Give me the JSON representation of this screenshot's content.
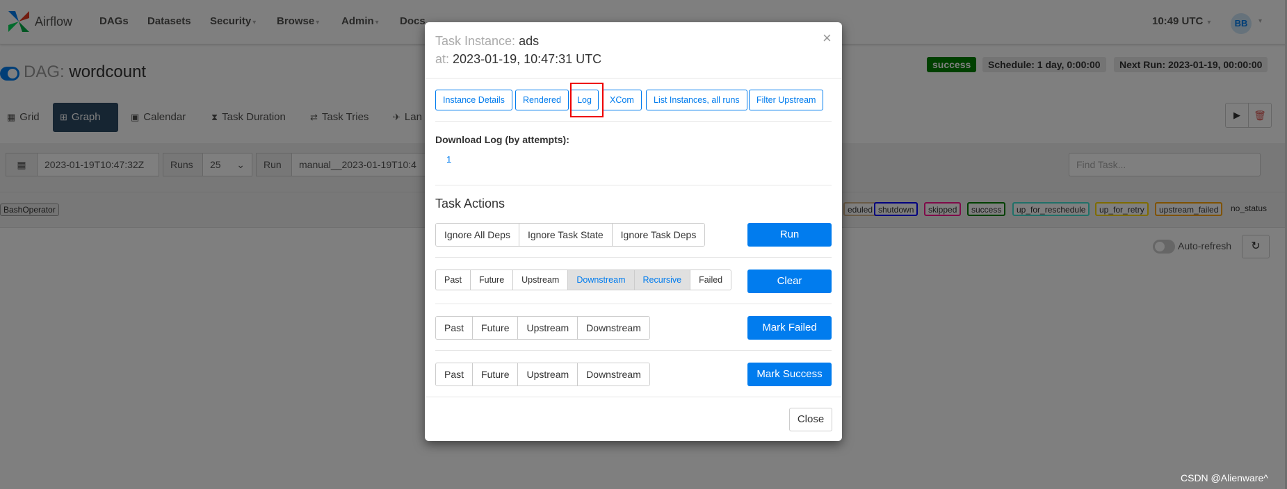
{
  "nav": {
    "brand": "Airflow",
    "items": [
      "DAGs",
      "Datasets",
      "Security",
      "Browse",
      "Admin",
      "Docs"
    ],
    "time": "10:49 UTC",
    "avatar": "BB"
  },
  "dag": {
    "prefix": "DAG:",
    "name": "wordcount",
    "status": "success",
    "schedule": "Schedule: 1 day, 0:00:00",
    "next_run": "Next Run: 2023-01-19, 00:00:00"
  },
  "tabs": [
    "Grid",
    "Graph",
    "Calendar",
    "Task Duration",
    "Task Tries",
    "Lan"
  ],
  "filters": {
    "date": "2023-01-19T10:47:32Z",
    "runs_label": "Runs",
    "runs_value": "25",
    "run_label": "Run",
    "run_value": "manual__2023-01-19T10:4",
    "find_placeholder": "Find Task..."
  },
  "legend": {
    "operator": "BashOperator",
    "states": [
      {
        "label": "eduled",
        "color": "#d2b48c"
      },
      {
        "label": "shutdown",
        "color": "#0000ff"
      },
      {
        "label": "skipped",
        "color": "#ff1493"
      },
      {
        "label": "success",
        "color": "#008000"
      },
      {
        "label": "up_for_reschedule",
        "color": "#40e0d0"
      },
      {
        "label": "up_for_retry",
        "color": "#ffd700"
      },
      {
        "label": "upstream_failed",
        "color": "#ffa500"
      }
    ],
    "no_status": "no_status"
  },
  "autorefresh": "Auto-refresh",
  "modal": {
    "title_label": "Task Instance:",
    "task": "ads",
    "at_label": "at:",
    "at_value": "2023-01-19, 10:47:31 UTC",
    "top_buttons": [
      "Instance Details",
      "Rendered",
      "Log",
      "XCom",
      "List Instances, all runs",
      "Filter Upstream"
    ],
    "download_label": "Download Log (by attempts):",
    "attempt": "1",
    "actions_title": "Task Actions",
    "run_options": [
      "Ignore All Deps",
      "Ignore Task State",
      "Ignore Task Deps"
    ],
    "run_label": "Run",
    "clear_options": [
      "Past",
      "Future",
      "Upstream",
      "Downstream",
      "Recursive",
      "Failed"
    ],
    "clear_label": "Clear",
    "failed_options": [
      "Past",
      "Future",
      "Upstream",
      "Downstream"
    ],
    "failed_label": "Mark Failed",
    "success_options": [
      "Past",
      "Future",
      "Upstream",
      "Downstream"
    ],
    "success_label": "Mark Success",
    "close_label": "Close"
  },
  "watermark": "CSDN @Alienware^"
}
